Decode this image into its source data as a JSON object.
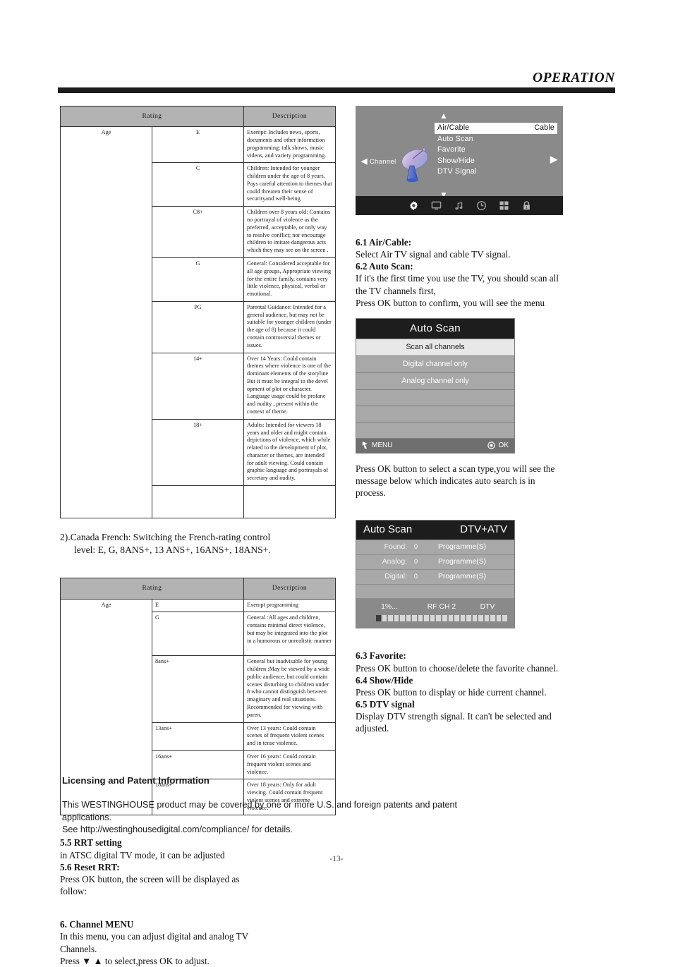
{
  "header": {
    "title": "OPERATION"
  },
  "footer": {
    "page_number": "-13-"
  },
  "table_english": {
    "headers": {
      "rating": "Rating",
      "description": "Description"
    },
    "axis_label": "Age",
    "rows": [
      {
        "code": "E",
        "desc": "Exempt: Includes news, sports, documents and other information programming: talk shows, music videos, and variety programming."
      },
      {
        "code": "C",
        "desc": "Children: Intended for younger children under the age of 8 years. Pays careful attention to themes that could threaten their sense of securityand well-being."
      },
      {
        "code": "C8+",
        "desc": "Children over 8 years old: Contains no portrayal of violence as the preferred, acceptable, or only way to resolve conflict; nor encourage children to imitate dangerous acts which they may see on the screen ."
      },
      {
        "code": "G",
        "desc": "General: Considered acceptable for all age groups, Appropriate viewing for the entire family, contains very little violence, physical, verbal or emotional."
      },
      {
        "code": "PG",
        "desc": "Parental Guidance: Intended for a general audience, but may not be suitable for younger children (under the age of 8) because it could contain controversial themes or issues."
      },
      {
        "code": "14+",
        "desc": "Over 14 Years: Could contain themes where violence is one of the dominant elements of the storyline But it must be integral to the devel opment of plot or character. Language usage could be profane and nudity , present within the context of theme."
      },
      {
        "code": "18+",
        "desc": "Adults: Intended for viewers 18 years and older and might contain depictions of  violence, which while related to the development of plot,  character or themes, are intended for adult  viewing. Could contain graphic language and portrayals of secretary and nudity."
      }
    ]
  },
  "canada_french_note": {
    "line1": "2).Canada French: Switching the French-rating control",
    "line2": "level: E, G, 8ANS+, 13 ANS+, 16ANS+, 18ANS+."
  },
  "table_french": {
    "headers": {
      "rating": "Rating",
      "description": "Description"
    },
    "axis_label": "Age",
    "rows": [
      {
        "code": "E",
        "desc": "Exempt programming"
      },
      {
        "code": "G",
        "desc": "General :All ages and children, contains minimal direct violence, but may be integrated into the plot in a humorous or unrealistic manner ."
      },
      {
        "code": "8ans+",
        "desc": "General but inadvisable for young children :May be viewed by a wide public audience, but could contain scenes disturbing to children under 8 who cannot distinguish between imaginary and real situations. Recommended for viewing with paren."
      },
      {
        "code": "13ans+",
        "desc": "Over 13 years: Could contain scenes of frequent violent scenes and in tense violence."
      },
      {
        "code": "16ans+",
        "desc": "Over 16 years: Could contain frequent violent scenes and violence."
      },
      {
        "code": "18ans+",
        "desc": "Over 18 years: Only for adult viewing. Could contain frequent violent  scenes and extreme violence."
      }
    ]
  },
  "left_sections": {
    "rrt_setting_heading": "5.5 RRT setting",
    "rrt_setting_body": "in ATSC digital TV mode, it can be adjusted",
    "reset_rrt_heading": "5.6 Reset RRT:",
    "reset_rrt_body_1": "Press OK button, the screen will be displayed as",
    "reset_rrt_body_2": "follow:",
    "channel_menu_heading": "6. Channel MENU",
    "channel_menu_body_1": "In this menu, you can adjust digital and analog TV",
    "channel_menu_body_2": "Channels.",
    "channel_menu_body_3": "Press ▼ ▲ to select,press OK to adjust."
  },
  "licensing": {
    "heading": "Licensing and Patent Information",
    "line1": "This WESTINGHOUSE product may be covered by one or more U.S. and foreign patents and patent",
    "line2": "applications.",
    "line3": "See http://westinghousedigital.com/compliance/ for details."
  },
  "osd_channel": {
    "left_label": "Channel",
    "left_arrow": "◀",
    "right_arrow": "▶",
    "arrow_up": "▲",
    "arrow_down": "▼",
    "items": [
      {
        "label": "Air/Cable",
        "value": "Cable",
        "selected": true
      },
      {
        "label": "Auto Scan",
        "value": "",
        "selected": false
      },
      {
        "label": "Favorite",
        "value": "",
        "selected": false
      },
      {
        "label": "Show/Hide",
        "value": "",
        "selected": false
      },
      {
        "label": "DTV Signal",
        "value": "",
        "selected": false
      }
    ],
    "toolbar_icons": [
      "gear-icon",
      "picture-icon",
      "audio-icon",
      "time-icon",
      "channel-grid-icon",
      "lock-icon"
    ],
    "lock_icon_badge": "1"
  },
  "right_sections": {
    "air_cable_heading": "6.1 Air/Cable:",
    "air_cable_body": "Select Air TV signal and cable TV signal.",
    "auto_scan_heading": "6.2 Auto Scan:",
    "auto_scan_body_1": "If it's the first time you use the TV, you should scan all",
    "auto_scan_body_2": "the TV channels first,",
    "auto_scan_body_3": "Press OK button to confirm, you will see the menu",
    "after_scan_1": "Press OK button to select a scan type,you will see the",
    "after_scan_2": "message below which indicates auto search is in",
    "after_scan_3": "process.",
    "favorite_heading": "6.3 Favorite:",
    "favorite_body": "Press OK button to choose/delete the favorite channel.",
    "showhide_heading": "6.4 Show/Hide",
    "showhide_body": "Press OK button to display or hide current channel.",
    "dtv_signal_heading": "6.5 DTV signal",
    "dtv_signal_body_1": "Display DTV strength signal. It can't be selected and",
    "dtv_signal_body_2": "adjusted."
  },
  "osd_auto_scan": {
    "title": "Auto Scan",
    "options": [
      {
        "label": "Scan all channels",
        "selected": true
      },
      {
        "label": "Digital channel only",
        "selected": false
      },
      {
        "label": "Analog channel only",
        "selected": false
      }
    ],
    "empty_rows": 3,
    "footer_menu": "MENU",
    "footer_ok": "OK"
  },
  "osd_scan_progress": {
    "title": "Auto Scan",
    "mode": "DTV+ATV",
    "rows": [
      {
        "key": "Found:",
        "value": "0",
        "unit": "Programme(S)"
      },
      {
        "key": "Analog:",
        "value": "0",
        "unit": "Programme(S)"
      },
      {
        "key": "Digital:",
        "value": "0",
        "unit": "Programme(S)"
      }
    ],
    "percent": "1%...",
    "rf_channel": "RF CH 2",
    "signal_mode": "DTV",
    "bar_total": 22,
    "bar_filled": 1
  }
}
